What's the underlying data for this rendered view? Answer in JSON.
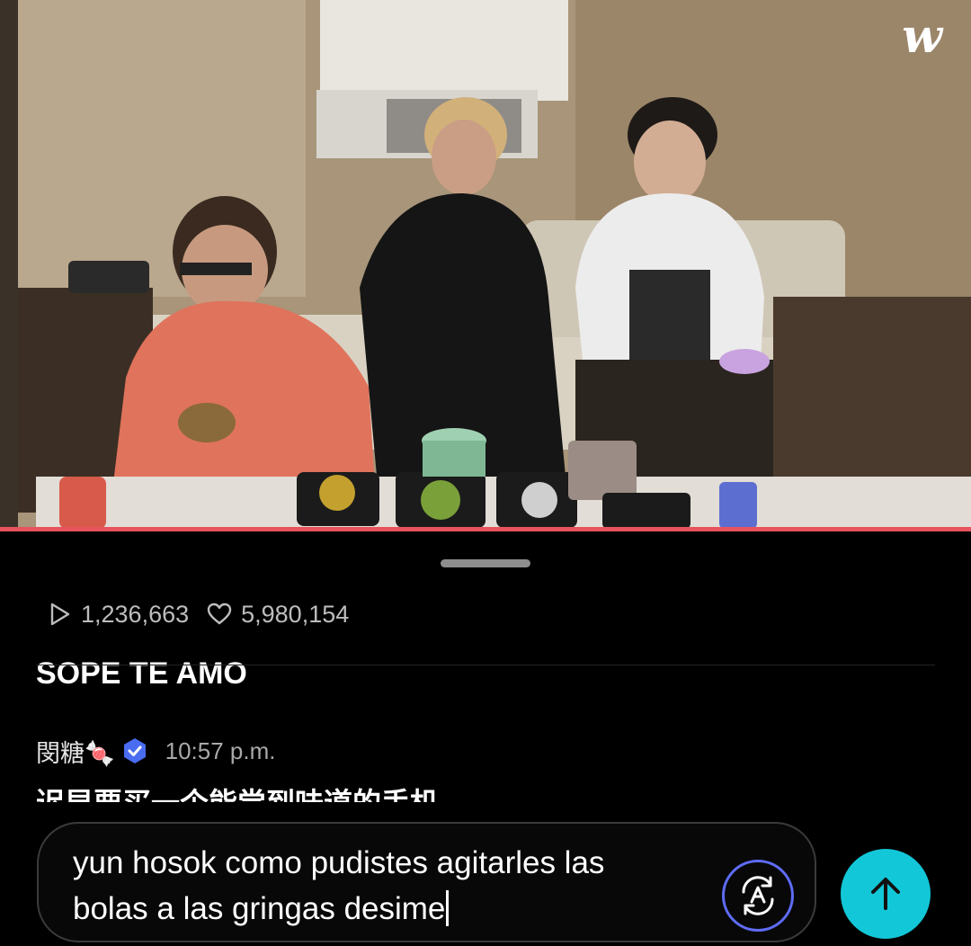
{
  "video": {
    "watermark": "w"
  },
  "stats": {
    "plays": "1,236,663",
    "likes": "5,980,154"
  },
  "comments": [
    {
      "text": "SOPE TE AMO"
    },
    {
      "user": "閔糖🍬",
      "time": "10:57 p.m.",
      "text": "迟早要买一个能尝到味道的手机"
    }
  ],
  "input": {
    "line1": "yun hosok como pudistes agitarles las",
    "line2": "bolas a las gringas desime"
  },
  "colors": {
    "accent": "#12c7d8",
    "progress": "#e8545e",
    "translate_ring": "#5e6cf7"
  },
  "icons": {
    "play": "play-icon",
    "heart": "heart-icon",
    "verified": "verified-badge-icon",
    "translate": "translate-icon",
    "send": "arrow-up-icon"
  }
}
